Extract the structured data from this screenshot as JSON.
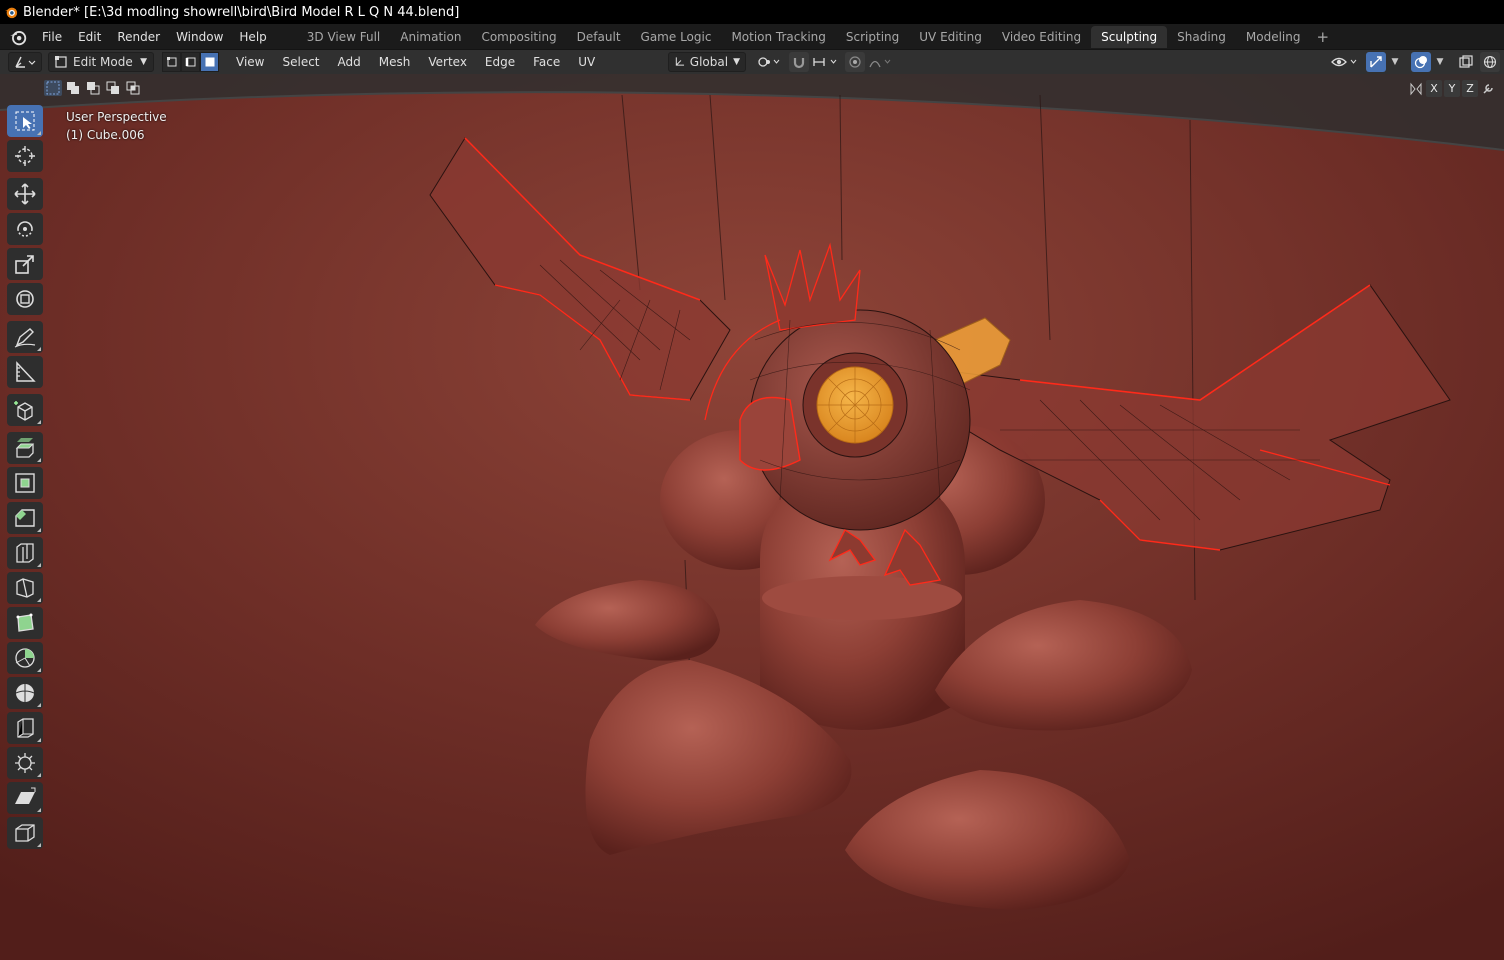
{
  "window": {
    "title": "Blender* [E:\\3d modling showrell\\bird\\Bird Model R L Q N 44.blend]"
  },
  "menus": [
    "File",
    "Edit",
    "Render",
    "Window",
    "Help"
  ],
  "workspaces": {
    "tabs": [
      "3D View Full",
      "Animation",
      "Compositing",
      "Default",
      "Game Logic",
      "Motion Tracking",
      "Scripting",
      "UV Editing",
      "Video Editing",
      "Sculpting",
      "Shading",
      "Modeling"
    ],
    "active": "Sculpting",
    "add_label": "+"
  },
  "viewport_header": {
    "mode": "Edit Mode",
    "menus": [
      "View",
      "Select",
      "Add",
      "Mesh",
      "Vertex",
      "Edge",
      "Face",
      "UV"
    ],
    "orientation": "Global",
    "axis_labels": [
      "X",
      "Y",
      "Z"
    ]
  },
  "viewport": {
    "view_name": "User Perspective",
    "object_name": "(1) Cube.006"
  },
  "toolbar": {
    "tools": [
      "select-box",
      "cursor",
      "move",
      "rotate",
      "scale",
      "transform",
      "annotate",
      "measure",
      "add-cube",
      "extrude-region",
      "inset-faces",
      "bevel",
      "loop-cut",
      "knife",
      "poly-build",
      "spin",
      "smooth",
      "edge-slide",
      "shrink-fatten",
      "shear",
      "rip-region"
    ],
    "active": "select-box"
  },
  "colors": {
    "accent": "#4772b3",
    "title_bg": "#000000",
    "header_bg": "#303030",
    "viewport_bg": "#6b2c25",
    "edge_highlight": "#ff2a1a",
    "selection_orange": "#f2a23a"
  }
}
